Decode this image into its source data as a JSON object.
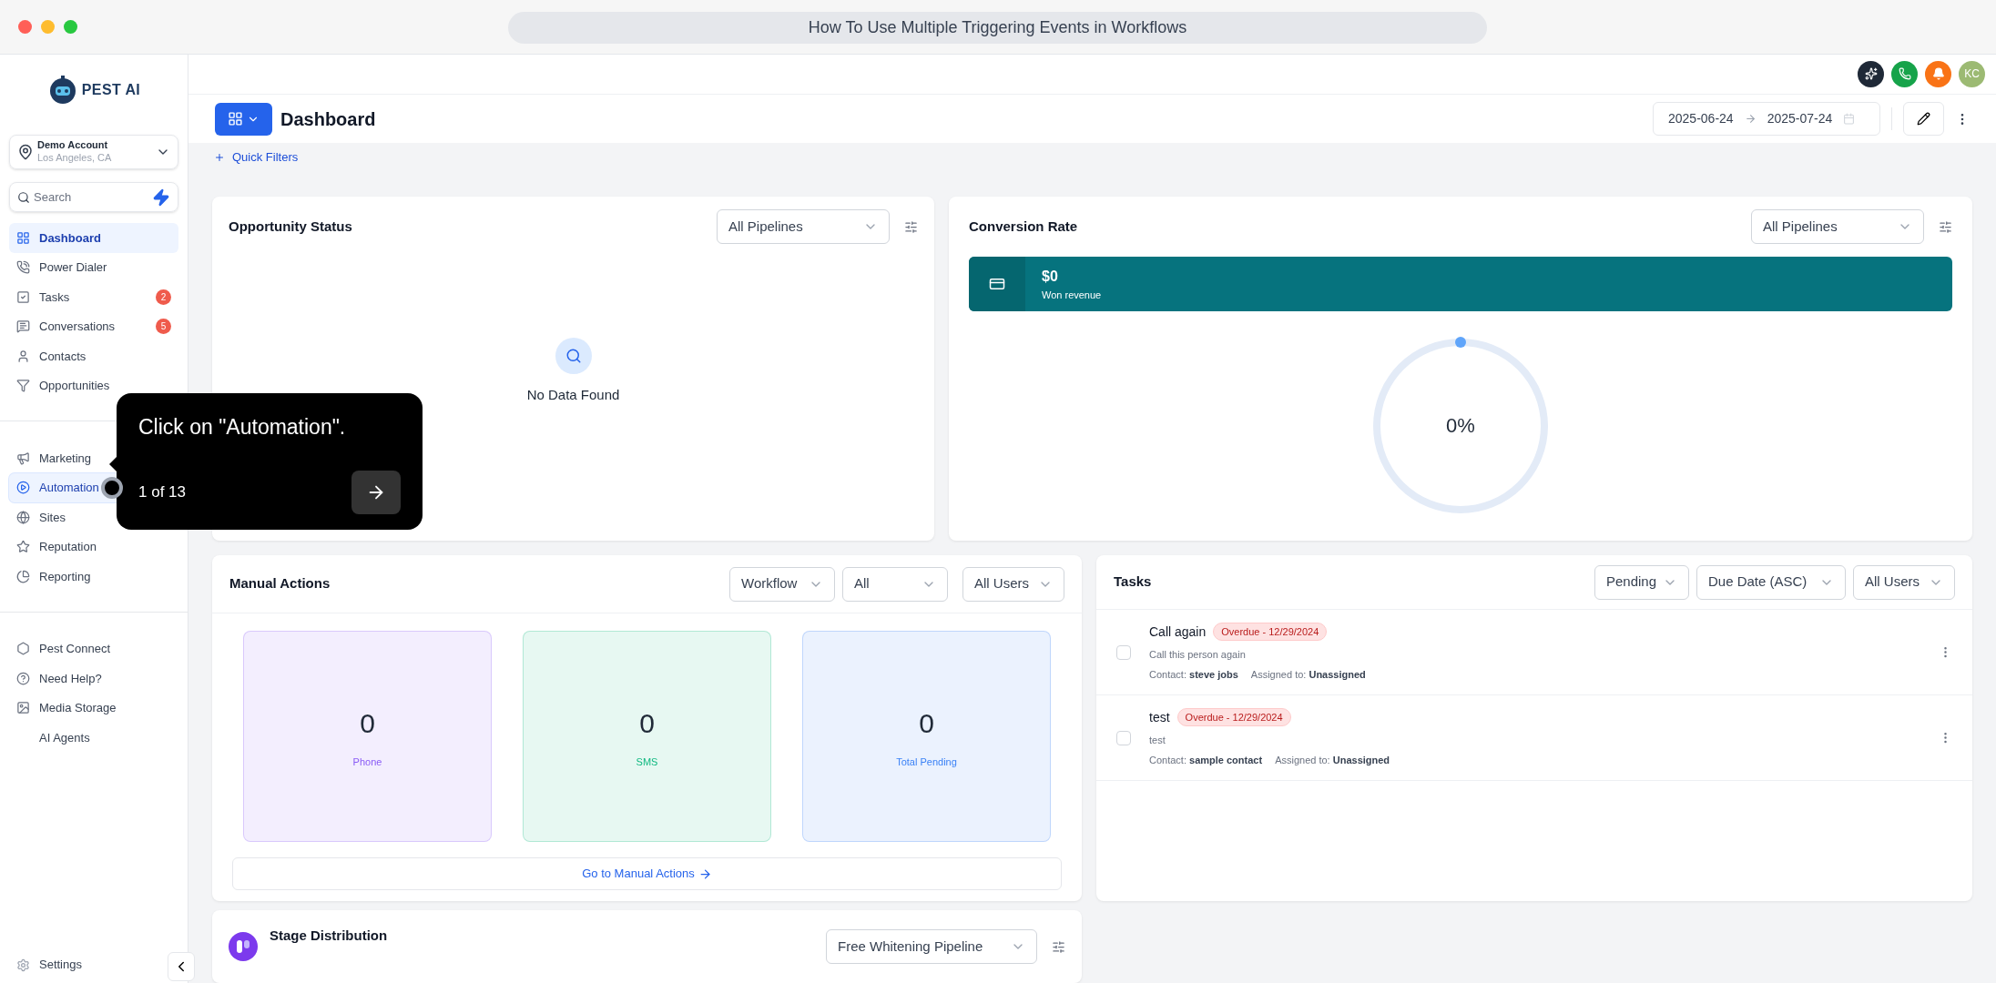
{
  "window": {
    "title": "How To Use Multiple Triggering Events in Workflows"
  },
  "sidebar": {
    "logo": "PEST AI",
    "account": {
      "name": "Demo Account",
      "location": "Los Angeles, CA"
    },
    "search": {
      "placeholder": "Search"
    },
    "groups": [
      [
        {
          "label": "Dashboard",
          "selected": true,
          "hovered": false
        },
        {
          "label": "Power Dialer",
          "selected": false,
          "hovered": false
        },
        {
          "label": "Tasks",
          "selected": false,
          "hovered": false,
          "badge": "2"
        },
        {
          "label": "Conversations",
          "selected": false,
          "hovered": false,
          "badge": "5"
        },
        {
          "label": "Contacts",
          "selected": false,
          "hovered": false
        },
        {
          "label": "Opportunities",
          "selected": false,
          "hovered": false
        }
      ],
      [
        {
          "label": "Marketing",
          "selected": false,
          "hovered": false
        },
        {
          "label": "Automation",
          "selected": false,
          "hovered": true
        },
        {
          "label": "Sites",
          "selected": false,
          "hovered": false
        },
        {
          "label": "Reputation",
          "selected": false,
          "hovered": false
        },
        {
          "label": "Reporting",
          "selected": false,
          "hovered": false
        }
      ],
      [
        {
          "label": "Pest Connect",
          "selected": false,
          "hovered": false
        },
        {
          "label": "Need Help?",
          "selected": false,
          "hovered": false
        },
        {
          "label": "Media Storage",
          "selected": false,
          "hovered": false
        },
        {
          "label": "AI Agents",
          "selected": false,
          "hovered": false
        }
      ]
    ],
    "settings": "Settings"
  },
  "topbar": {
    "avatar": "KC"
  },
  "header": {
    "title": "Dashboard",
    "date_from": "2025-06-24",
    "date_to": "2025-07-24",
    "quick_filters": "Quick Filters"
  },
  "opportunity_status": {
    "title": "Opportunity Status",
    "filter": "All Pipelines",
    "empty": "No Data Found"
  },
  "conversion_rate": {
    "title": "Conversion Rate",
    "filter": "All Pipelines",
    "revenue": "$0",
    "revenue_label": "Won revenue",
    "percent": "0%"
  },
  "manual_actions": {
    "title": "Manual Actions",
    "filters": [
      "Workflow",
      "All",
      "All Users"
    ],
    "stats": [
      {
        "value": "0",
        "label": "Phone",
        "color": "#8b5cf6"
      },
      {
        "value": "0",
        "label": "SMS",
        "color": "#10b981"
      },
      {
        "value": "0",
        "label": "Total Pending",
        "color": "#3b82f6"
      }
    ],
    "link": "Go to Manual Actions"
  },
  "tasks": {
    "title": "Tasks",
    "filters": [
      "Pending",
      "Due Date (ASC)",
      "All Users"
    ],
    "items": [
      {
        "title": "Call again",
        "badge": "Overdue - 12/29/2024",
        "description": "Call this person again",
        "contact_label": "Contact:",
        "contact": "steve jobs",
        "assigned_label": "Assigned to:",
        "assigned": "Unassigned",
        "checked": false
      },
      {
        "title": "test",
        "badge": "Overdue - 12/29/2024",
        "description": "test",
        "contact_label": "Contact:",
        "contact": "sample contact",
        "assigned_label": "Assigned to:",
        "assigned": "Unassigned",
        "checked": false
      }
    ]
  },
  "stage_distribution": {
    "title": "Stage Distribution",
    "filter": "Free Whitening Pipeline"
  },
  "tooltip": {
    "text": "Click on \"Automation\".",
    "step": "1 of 13"
  }
}
